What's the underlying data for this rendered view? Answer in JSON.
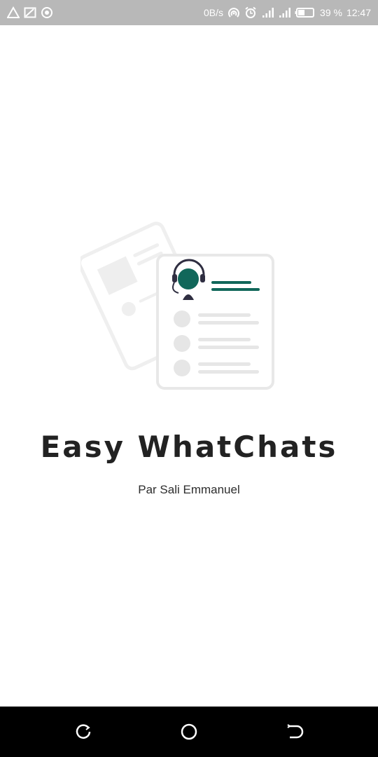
{
  "status_bar": {
    "left_icons": [
      "alert-triangle-icon",
      "screen-cast-icon",
      "sync-circle-icon"
    ],
    "network_speed": "0B/s",
    "battery_percent": "39 %",
    "time": "12:47"
  },
  "app": {
    "title": "Easy WhatChats",
    "subtitle": "Par Sali Emmanuel"
  },
  "colors": {
    "accent": "#11675a",
    "illustration_gray": "#e6e6e6",
    "status_bar_bg": "#b8b8b8",
    "nav_bar_bg": "#000000"
  },
  "nav_bar": {
    "buttons": [
      "back-icon",
      "home-icon",
      "recent-apps-icon"
    ]
  }
}
